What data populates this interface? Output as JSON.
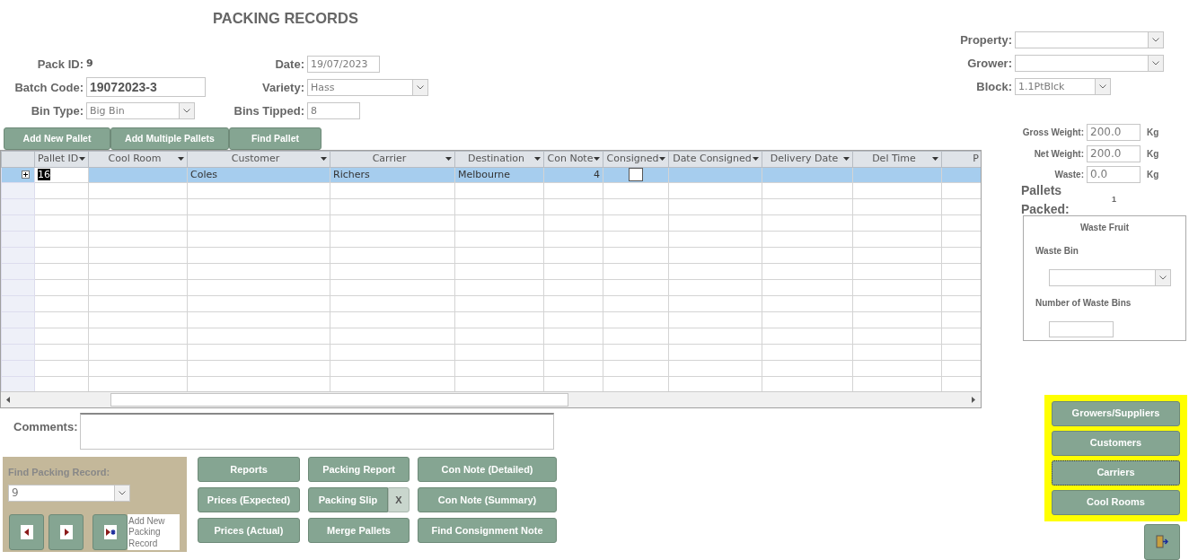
{
  "title": "PACKING RECORDS",
  "header_fields": [
    {
      "label": "Pack ID:",
      "kind": "value",
      "value": "9"
    },
    {
      "label": "Date:",
      "kind": "text",
      "value": "19/07/2023"
    },
    {
      "label": "Batch Code:",
      "kind": "text-large",
      "value": "19072023-3"
    },
    {
      "label": "Variety:",
      "kind": "combo",
      "value": "Hass"
    },
    {
      "label": "Bin Type:",
      "kind": "combo",
      "value": "Big Bin"
    },
    {
      "label": "Bins Tipped:",
      "kind": "text",
      "value": "8"
    }
  ],
  "site_fields": [
    {
      "label": "Property:"
    },
    {
      "label": "Grower:"
    },
    {
      "label": "Block:",
      "value": "1.1PtBlck"
    }
  ],
  "pallet_buttons": [
    "Add New Pallet",
    "Add Multiple Pallets",
    "Find Pallet"
  ],
  "table": {
    "columns": [
      {
        "label": "Pallet ID",
        "kind": "text"
      },
      {
        "label": "Cool Room",
        "kind": "text"
      },
      {
        "label": "Customer",
        "kind": "text"
      },
      {
        "label": "Carrier",
        "kind": "text"
      },
      {
        "label": "Destination",
        "kind": "text"
      },
      {
        "label": "Con Note",
        "kind": "number"
      },
      {
        "label": "Consigned",
        "kind": "check"
      },
      {
        "label": "Date Consigned",
        "kind": "text"
      },
      {
        "label": "Delivery Date",
        "kind": "text"
      },
      {
        "label": "Del Time",
        "kind": "text"
      },
      {
        "label": "P",
        "kind": "cut"
      }
    ],
    "rows": [
      {
        "selected": true,
        "expanded": false,
        "cells": [
          "16",
          null,
          "Coles",
          "Richers",
          "Melbourne",
          "4",
          false,
          null,
          null,
          null,
          null
        ]
      }
    ]
  },
  "comments": {
    "label": "Comments:"
  },
  "find_record": {
    "label": "Find Packing Record:",
    "value": "9",
    "new_record_label": "Add New Packing Record"
  },
  "action_buttons": [
    {
      "label": "Reports"
    },
    {
      "label": "Packing Report"
    },
    {
      "label": "Con Note (Detailed)"
    },
    {
      "label": "Prices (Expected)"
    },
    {
      "label": "Packing Slip",
      "clear_label": "X"
    },
    {
      "label": "Con Note (Summary)"
    },
    {
      "label": "Prices (Actual)"
    },
    {
      "label": "Merge Pallets"
    },
    {
      "label": "Find Consignment Note"
    }
  ],
  "weights": [
    {
      "label": "Gross Weight:",
      "value": "200.0",
      "unit": "Kg"
    },
    {
      "label": "Net Weight:",
      "value": "200.0",
      "unit": "Kg"
    },
    {
      "label": "Waste:",
      "value": "0.0",
      "unit": "Kg"
    }
  ],
  "pallets_packed": {
    "label": "Pallets Packed:",
    "value": "1"
  },
  "waste_fruit": {
    "title": "Waste Fruit",
    "bin_label": "Waste Bin",
    "count_label": "Number of Waste Bins"
  },
  "setup_buttons": [
    {
      "label": "Growers/Suppliers",
      "focused": false
    },
    {
      "label": "Customers",
      "focused": false
    },
    {
      "label": "Carriers",
      "focused": true
    },
    {
      "label": "Cool Rooms",
      "focused": false
    }
  ]
}
